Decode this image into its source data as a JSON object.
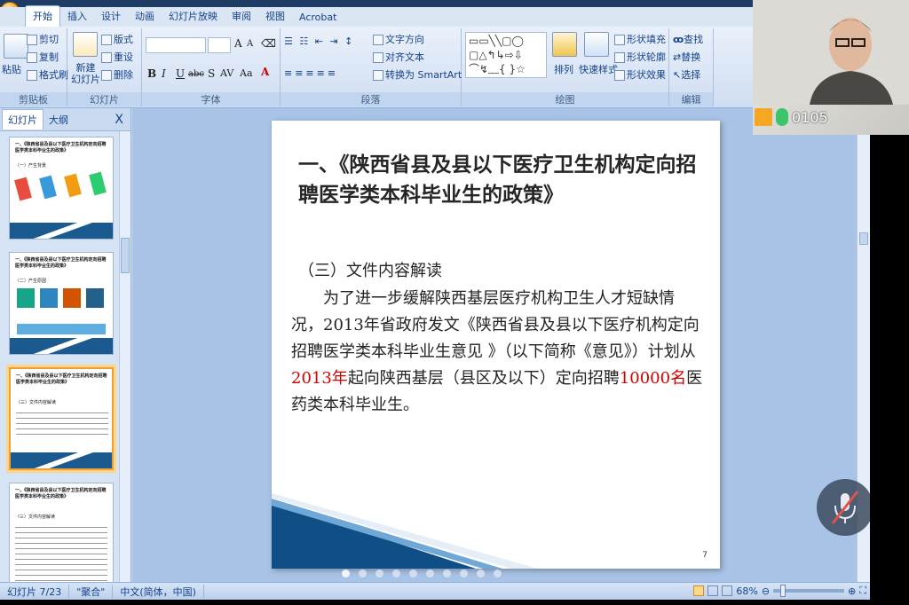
{
  "ribbon": {
    "tabs": [
      "开始",
      "插入",
      "设计",
      "动画",
      "幻灯片放映",
      "审阅",
      "视图",
      "Acrobat"
    ],
    "groups": {
      "clipboard": {
        "label": "剪贴板",
        "paste": "粘贴",
        "cut": "剪切",
        "copy": "复制",
        "format_painter": "格式刷"
      },
      "slides": {
        "label": "幻灯片",
        "new_slide": "新建\n幻灯片",
        "layout": "版式",
        "reset": "重设",
        "delete": "删除"
      },
      "font": {
        "label": "字体",
        "bold": "B",
        "italic": "I",
        "underline": "U",
        "strike": "abc",
        "shadow": "S",
        "spacing": "AV",
        "case": "Aa"
      },
      "paragraph": {
        "label": "段落",
        "text_direction": "文字方向",
        "align_text": "对齐文本",
        "smartart": "转换为 SmartArt"
      },
      "drawing": {
        "label": "绘图",
        "arrange": "排列",
        "quick_styles": "快速样式",
        "shape_fill": "形状填充",
        "shape_outline": "形状轮廓",
        "shape_effects": "形状效果"
      },
      "editing": {
        "label": "编辑",
        "find": "查找",
        "replace": "替换",
        "select": "选择"
      }
    }
  },
  "left_pane": {
    "tabs": [
      "幻灯片",
      "大纲"
    ],
    "close": "X",
    "thumbs": [
      {
        "title": "一、《陕西省县及县以下医疗卫生机构定向招聘医学类本科毕业生的政策》",
        "sub": "（一）产生背景"
      },
      {
        "title": "一、《陕西省县及县以下医疗卫生机构定向招聘医学类本科毕业生的政策》",
        "sub": "（二）产生原因"
      },
      {
        "title": "一、《陕西省县及县以下医疗卫生机构定向招聘医学类本科毕业生的政策》",
        "sub": "（三）文件内容解读"
      },
      {
        "title": "一、《陕西省县及县以下医疗卫生机构定向招聘医学类本科毕业生的政策》",
        "sub": "（三）文件内容解读"
      }
    ]
  },
  "slide": {
    "title": "一、《陕西省县及县以下医疗卫生机构定向招聘医学类本科毕业生的政策》",
    "subtitle": "（三）文件内容解读",
    "body_a": "为了进一步缓解陕西基层医疗机构卫生人才短缺情况，2013年省政府发文《陕西省县及县以下医疗机构定向招聘医学类本科毕业生意见 》（以下简称《意见》）计划从",
    "body_red1": "2013年",
    "body_b": "起向陕西基层（县区及以下）定向招聘",
    "body_red2": "10000名",
    "body_c": "医药类本科毕业生。",
    "page_number": "7"
  },
  "status": {
    "slide_counter": "幻灯片 7/23",
    "theme": "\"聚合\"",
    "language": "中文(简体，中国)",
    "zoom": "68%"
  },
  "webcam": {
    "code": "0105"
  }
}
